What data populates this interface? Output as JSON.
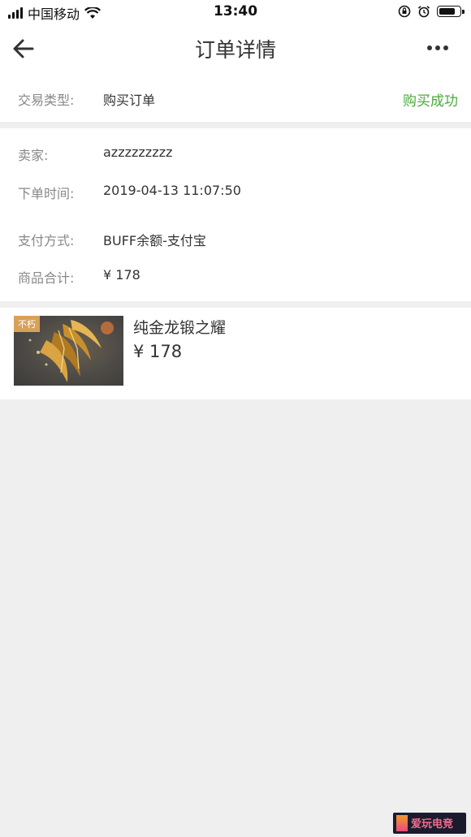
{
  "status_bar": {
    "carrier": "中国移动",
    "time": "13:40"
  },
  "header": {
    "title": "订单详情",
    "back_icon": "arrow-left-icon",
    "more_icon": "more-horizontal-icon"
  },
  "order": {
    "type_label": "交易类型:",
    "type_value": "购买订单",
    "status": "购买成功",
    "seller_label": "卖家:",
    "seller_value": "azzzzzzzzz",
    "time_label": "下单时间:",
    "time_value": "2019-04-13 11:07:50",
    "payment_label": "支付方式:",
    "payment_value": "BUFF余额-支付宝",
    "total_label": "商品合计:",
    "total_value": "¥ 178"
  },
  "item": {
    "badge": "不朽",
    "name": "纯金龙锻之耀",
    "price": "¥ 178"
  },
  "colors": {
    "status_green": "#4aaa3a",
    "badge_orange": "#d8a158",
    "page_bg": "#efefef"
  }
}
